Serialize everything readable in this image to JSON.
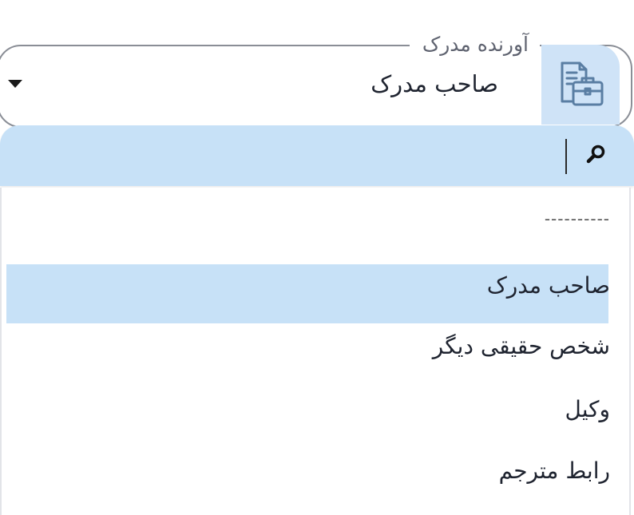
{
  "field": {
    "label": "آورنده مدرک",
    "selected_value": "صاحب مدرک",
    "icon": "document-briefcase-icon",
    "dropdown_icon": "caret-down-icon"
  },
  "search": {
    "value": "",
    "icon": "search-icon"
  },
  "options": [
    {
      "label": "----------",
      "selected": false
    },
    {
      "label": "صاحب مدرک",
      "selected": true
    },
    {
      "label": "شخص حقیقی دیگر",
      "selected": false
    },
    {
      "label": "وکیل",
      "selected": false
    },
    {
      "label": "رابط مترجم",
      "selected": false
    }
  ],
  "colors": {
    "accent_bg": "#c7e1f7",
    "icon_bg": "#cfe3f7",
    "icon_stroke": "#5a7ea3",
    "text": "#1f2430"
  }
}
